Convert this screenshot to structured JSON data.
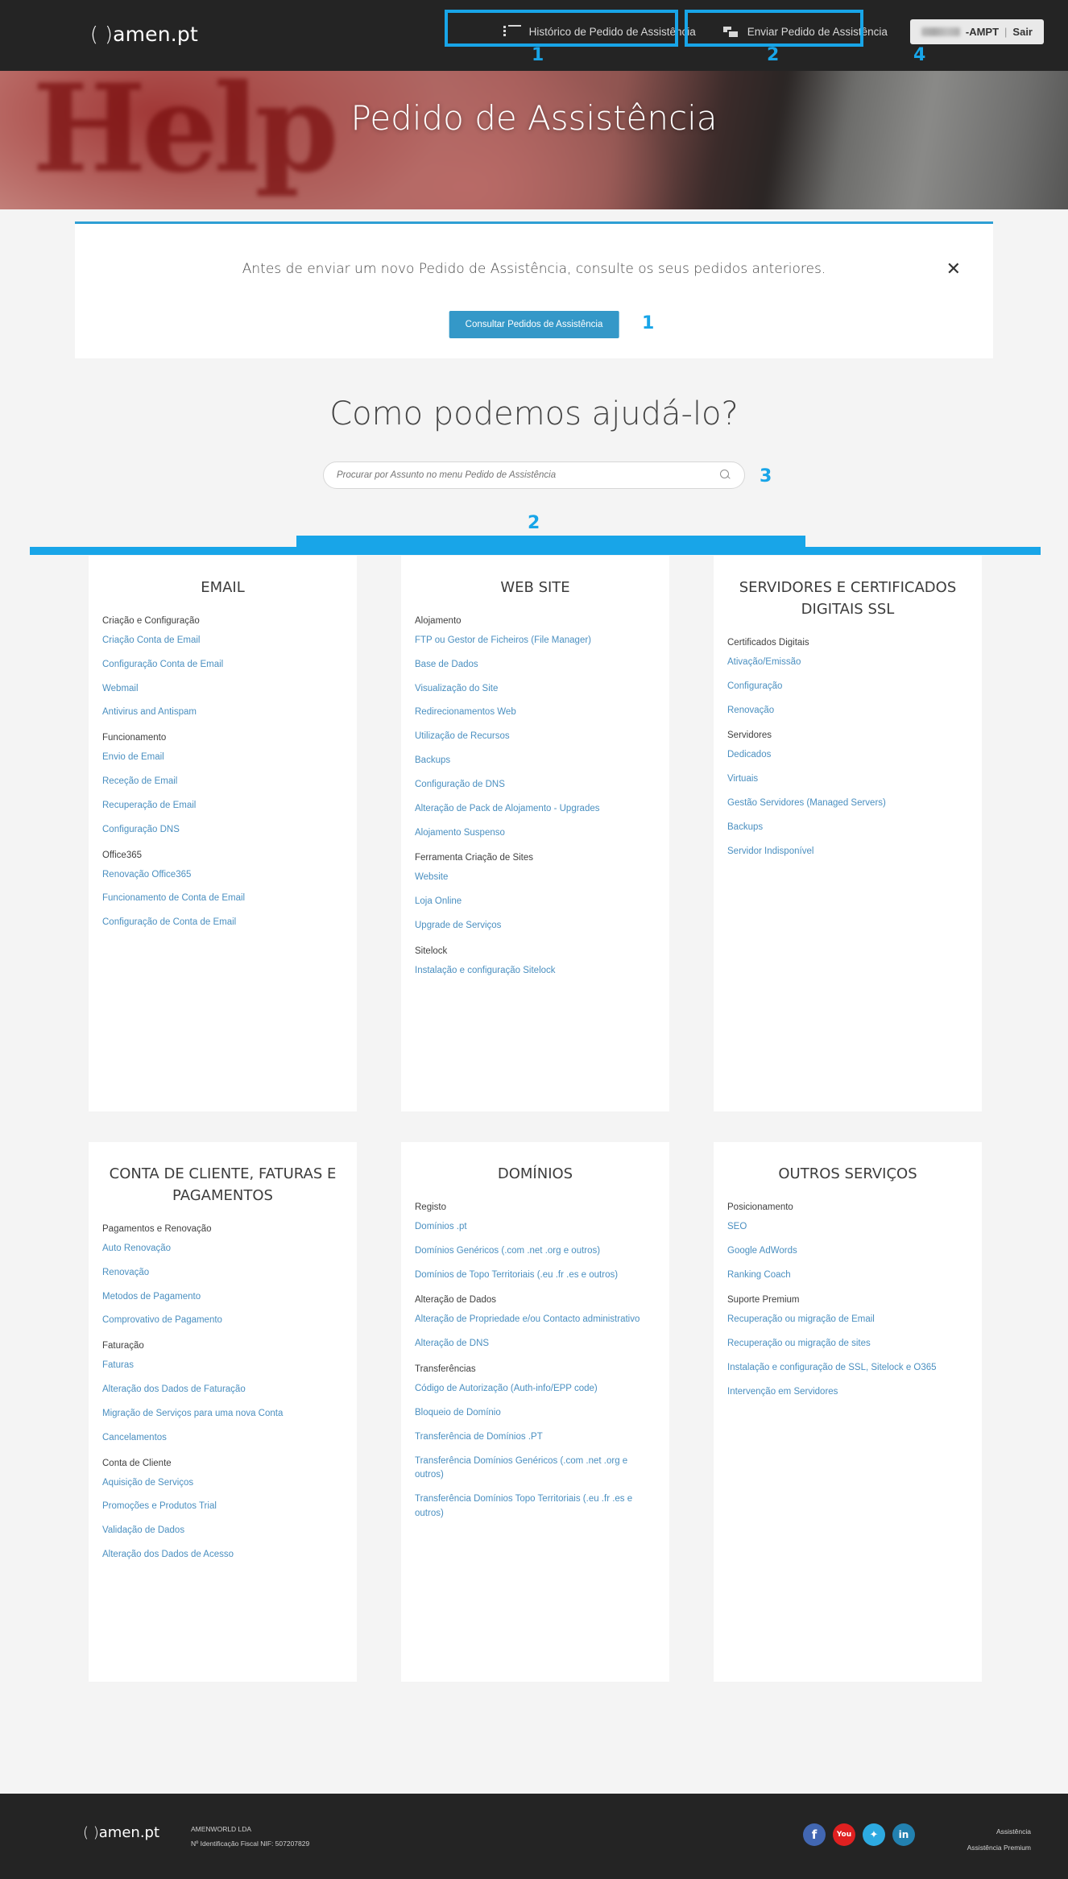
{
  "header": {
    "logo_paren": "( )",
    "logo_text": "amen.pt",
    "nav": [
      {
        "label": "Histórico de Pedido de Assistência",
        "icon": "list-icon"
      },
      {
        "label": "Enviar Pedido de Assistência",
        "icon": "chat-bubbles-icon"
      }
    ],
    "user_chip": {
      "account": "-AMPT",
      "separator": "|",
      "logout": "Sair"
    }
  },
  "hero": {
    "title": "Pedido de Assistência",
    "scribble": "Help"
  },
  "notice": {
    "message": "Antes de enviar um novo Pedido de Assistência, consulte os seus pedidos anteriores.",
    "button": "Consultar Pedidos de Assistência",
    "close_icon": "✕"
  },
  "search": {
    "heading": "Como podemos ajudá-lo?",
    "placeholder": "Procurar por Assunto no menu Pedido de Assistência",
    "value": "",
    "icon": "search-icon"
  },
  "cards": [
    {
      "title": "EMAIL",
      "groups": [
        {
          "label": "Criação e Configuração",
          "links": [
            "Criação Conta de Email",
            "Configuração Conta de Email",
            "Webmail",
            "Antivirus and Antispam"
          ]
        },
        {
          "label": "Funcionamento",
          "links": [
            "Envio de Email",
            "Receção de Email",
            "Recuperação de Email",
            "Configuração DNS"
          ]
        },
        {
          "label": "Office365",
          "links": [
            "Renovação Office365",
            "Funcionamento de Conta de Email",
            "Configuração de Conta de Email"
          ]
        }
      ]
    },
    {
      "title": "WEB SITE",
      "groups": [
        {
          "label": "Alojamento",
          "links": [
            "FTP ou Gestor de Ficheiros (File Manager)",
            "Base de Dados",
            "Visualização do Site",
            "Redirecionamentos Web",
            "Utilização de Recursos",
            "Backups",
            "Configuração de DNS",
            "Alteração de Pack de Alojamento - Upgrades",
            "Alojamento Suspenso"
          ]
        },
        {
          "label": "Ferramenta Criação de Sites",
          "links": [
            "Website",
            "Loja Online",
            "Upgrade de Serviços"
          ]
        },
        {
          "label": "Sitelock",
          "links": [
            "Instalação e configuração Sitelock"
          ]
        }
      ]
    },
    {
      "title": "SERVIDORES E CERTIFICADOS DIGITAIS SSL",
      "groups": [
        {
          "label": "Certificados Digitais",
          "links": [
            "Ativação/Emissão",
            "Configuração",
            "Renovação"
          ]
        },
        {
          "label": "Servidores",
          "links": [
            "Dedicados",
            "Virtuais",
            "Gestão Servidores (Managed Servers)",
            "Backups",
            "Servidor Indisponível"
          ]
        }
      ]
    },
    {
      "title": "CONTA DE CLIENTE, FATURAS E PAGAMENTOS",
      "groups": [
        {
          "label": "Pagamentos e Renovação",
          "links": [
            "Auto Renovação",
            "Renovação",
            "Metodos de Pagamento",
            "Comprovativo de Pagamento"
          ]
        },
        {
          "label": "Faturação",
          "links": [
            "Faturas",
            "Alteração dos Dados de Faturação",
            "Migração de Serviços para uma nova Conta",
            "Cancelamentos"
          ]
        },
        {
          "label": "Conta de Cliente",
          "links": [
            "Aquisição de Serviços",
            "Promoções e Produtos Trial",
            "Validação de Dados",
            "Alteração dos Dados de Acesso"
          ]
        }
      ]
    },
    {
      "title": "DOMÍNIOS",
      "groups": [
        {
          "label": "Registo",
          "links": [
            "Domínios .pt",
            "Domínios Genéricos (.com .net .org e outros)",
            "Domínios de Topo Territoriais (.eu .fr .es e outros)"
          ]
        },
        {
          "label": "Alteração de Dados",
          "links": [
            "Alteração de Propriedade e/ou Contacto administrativo",
            "Alteração de DNS"
          ]
        },
        {
          "label": "Transferências",
          "links": [
            "Código de Autorização (Auth-info/EPP code)",
            "Bloqueio de Domínio",
            "Transferência de Domínios .PT",
            "Transferência Domínios Genéricos (.com .net .org e outros)",
            "Transferência Domínios Topo Territoriais (.eu .fr .es e outros)"
          ]
        }
      ]
    },
    {
      "title": "OUTROS SERVIÇOS",
      "groups": [
        {
          "label": "Posicionamento",
          "links": [
            "SEO",
            "Google AdWords",
            "Ranking Coach"
          ]
        },
        {
          "label": "Suporte Premium",
          "links": [
            "Recuperação ou migração de Email",
            "Recuperação ou migração de sites",
            "Instalação e configuração de SSL, Sitelock e O365",
            "Intervenção em Servidores"
          ]
        }
      ]
    }
  ],
  "footer": {
    "logo_paren": "( )",
    "logo_text": "amen.pt",
    "company": "AMENWORLD LDA",
    "nif": "Nº Identificação Fiscal NIF: 507207829",
    "socials": [
      {
        "name": "facebook-icon",
        "glyph": "f"
      },
      {
        "name": "youtube-icon",
        "glyph": "▶"
      },
      {
        "name": "twitter-icon",
        "glyph": "🐦"
      },
      {
        "name": "linkedin-icon",
        "glyph": "in"
      }
    ],
    "links": [
      "Assistência",
      "Assistência Premium"
    ]
  },
  "annotations": {
    "accent": "#18a5e8",
    "markers": [
      {
        "id": "1",
        "target": "nav-historico"
      },
      {
        "id": "2",
        "target": "nav-enviar"
      },
      {
        "id": "4",
        "target": "user-chip"
      },
      {
        "id": "1",
        "target": "consultar-button"
      },
      {
        "id": "3",
        "target": "search-input"
      },
      {
        "id": "2",
        "target": "cards-grid"
      }
    ]
  }
}
